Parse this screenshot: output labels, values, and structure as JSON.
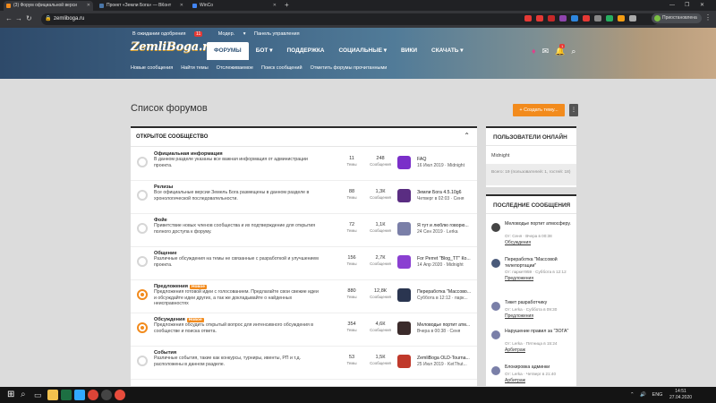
{
  "browser": {
    "tabs": [
      {
        "label": "(3) Форум официальной верси",
        "active": true,
        "color": "#f28b1d"
      },
      {
        "label": "Проект «Земли Бога» — ВКонт",
        "active": false,
        "color": "#4a76a8"
      },
      {
        "label": "WinCo",
        "active": false,
        "color": "#4285f4"
      }
    ],
    "new_tab": "+",
    "url": "zemliboga.ru",
    "profile": "Приостановлена",
    "window_controls": [
      "—",
      "❐",
      "✕"
    ]
  },
  "site": {
    "awaiting": "В ожидании одобрения",
    "awaiting_count": "11",
    "moder": "Модер.",
    "panel": "Панель управления",
    "logo": "ZemliBoga.ru",
    "nav": [
      {
        "label": "ФОРУМЫ",
        "active": true
      },
      {
        "label": "БОТ",
        "chev": true
      },
      {
        "label": "ПОДДЕРЖКА"
      },
      {
        "label": "СОЦИАЛЬНЫЕ",
        "chev": true
      },
      {
        "label": "ВИКИ"
      },
      {
        "label": "СКАЧАТЬ",
        "chev": true
      }
    ],
    "alerts_count": "1",
    "subnav": [
      "Новые сообщения",
      "Найти темы",
      "Отслеживаемое",
      "Поиск сообщений",
      "Отметить форумы прочитанными"
    ]
  },
  "page": {
    "title": "Список форумов",
    "create_button": "+ Создать тему..."
  },
  "forum": {
    "section": "ОТКРЫТОЕ СООБЩЕСТВО",
    "threads_label": "Темы",
    "posts_label": "Сообщения",
    "new_badge": "Новое",
    "rows": [
      {
        "title": "Официальная информация",
        "desc": "В данном разделе указаны все важная информация от администрации проекта.",
        "threads": "11",
        "posts": "248",
        "last_title": "FAQ",
        "last_meta": "16 Июл 2019 · Midnight",
        "color": "#7a2fc9",
        "unread": false,
        "isnew": false
      },
      {
        "title": "Релизы",
        "desc": "Все официальные версии Земель Бога размещены в данном разделе в хронологической последовательности.",
        "threads": "88",
        "posts": "1,3К",
        "last_title": "Земли Бога 4.5.10g6",
        "last_meta": "Четверг в 02:03 · Сеня",
        "color": "#5a2d82",
        "unread": false,
        "isnew": false
      },
      {
        "title": "Фойе",
        "desc": "Приветствие новых членов сообщества и их подтверждение для открытия полного доступа к форуму.",
        "threads": "72",
        "posts": "1,1К",
        "last_title": "Я тут и люблю говорю...",
        "last_meta": "24 Сен 2019 · Lerka",
        "color": "#7a7fa8",
        "unread": false,
        "isnew": false
      },
      {
        "title": "Общение",
        "desc": "Различные обсуждения на темы не связанные с разработкой и улучшением проекта.",
        "threads": "156",
        "posts": "2,7К",
        "last_title": "For Perret \"Blog_TT\" Ко...",
        "last_meta": "14 Апр 2020 · Midnight",
        "color": "#8a3fd1",
        "unread": false,
        "isnew": false
      },
      {
        "title": "Предложения",
        "desc": "Предложения готовой идеи с голосованием. Предлагайте свои свежие идеи и обсуждайте идеи других, а так же докладывайте о найденных неисправностях",
        "threads": "880",
        "posts": "12,8К",
        "last_title": "Переработка \"Массово...",
        "last_meta": "Суббота в 12:12 · парк...",
        "color": "#2a3550",
        "unread": true,
        "isnew": true
      },
      {
        "title": "Обсуждения",
        "desc": "Предложения обсудить открытый вопрос для интенсивного обсуждения в сообществе и поиска ответа.",
        "threads": "354",
        "posts": "4,6К",
        "last_title": "Меловодье портит атм...",
        "last_meta": "Вчера в 00:38 · Сеня",
        "color": "#3b2b2b",
        "unread": true,
        "isnew": true
      },
      {
        "title": "События",
        "desc": "Различные события, такие как конкурсы, турниры, ивенты, РП и т.д. расположены в данном разделе.",
        "threads": "53",
        "posts": "1,5К",
        "last_title": "ZemliBoga OLD-Tourna...",
        "last_meta": "25 Июл 2019 · KetThut...",
        "color": "#c0392b",
        "unread": false,
        "isnew": false
      }
    ]
  },
  "online": {
    "title": "ПОЛЬЗОВАТЕЛИ ОНЛАЙН",
    "users": "Midnight",
    "footer": "Всего: 19 (пользователей: 1, гостей: 18)"
  },
  "latest": {
    "title": "ПОСЛЕДНИЕ СООБЩЕНИЯ",
    "items": [
      {
        "title": "Меловодье портит атмосферу.",
        "meta": "От: Сеня · Вчера в 00:38",
        "forum": "Обсуждения",
        "color": "#444"
      },
      {
        "title": "Переработка \"Массовой телепортации\"",
        "meta": "От: паркет959 · Суббота в 12:12",
        "forum": "Предложения",
        "color": "#4a5a7a"
      },
      {
        "title": "Тикет разработчику",
        "meta": "От: Lerka · Суббота в 09:30",
        "forum": "Предложения",
        "color": "#7a7fa8"
      },
      {
        "title": "Нарушение правил за \"ЗОГА\"",
        "meta": "От: Lerka · Пятница в 15:24",
        "forum": "Арбитраж",
        "color": "#7a7fa8"
      },
      {
        "title": "Блокировка админки",
        "meta": "От: Lerka · Четверг в 21:40",
        "forum": "Арбитраж",
        "color": "#7a7fa8"
      }
    ]
  },
  "taskbar": {
    "lang": "ENG",
    "time": "14:51",
    "date": "27.04.2020",
    "apps": [
      {
        "name": "windows",
        "color": "#ffffff"
      },
      {
        "name": "search",
        "color": "#cccccc"
      },
      {
        "name": "taskview",
        "color": "#cccccc"
      },
      {
        "name": "explorer",
        "color": "#f2c14e"
      },
      {
        "name": "excel",
        "color": "#1d6f42"
      },
      {
        "name": "photoshop",
        "color": "#31a8ff"
      },
      {
        "name": "chrome",
        "color": "#db4437"
      },
      {
        "name": "obs",
        "color": "#444444"
      },
      {
        "name": "app",
        "color": "#e74c3c"
      }
    ]
  }
}
